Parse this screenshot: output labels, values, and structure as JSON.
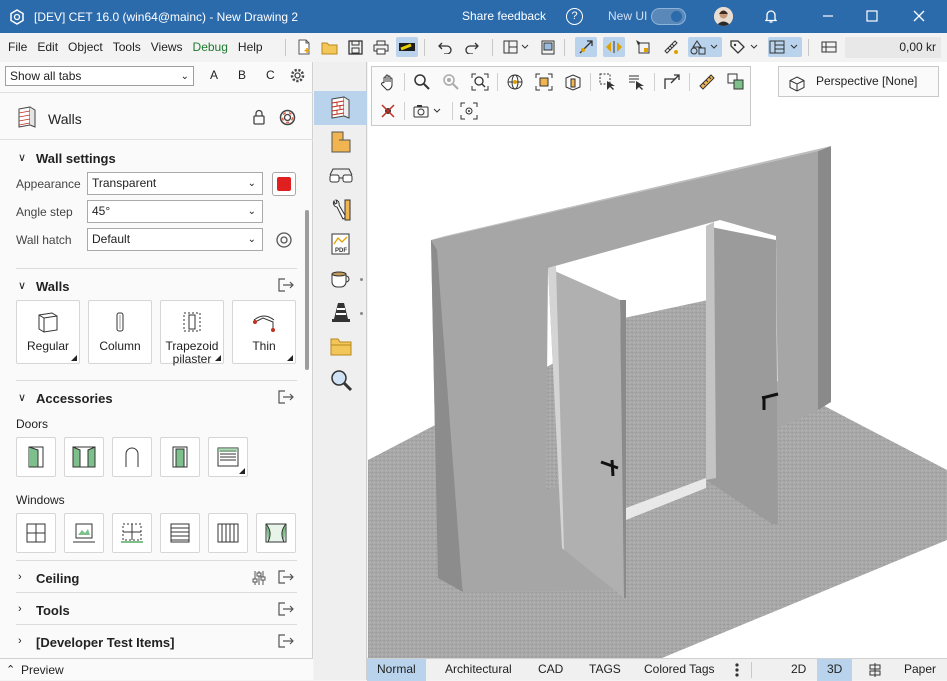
{
  "titlebar": {
    "title": "[DEV] CET 16.0 (win64@mainc) - New Drawing 2",
    "share_feedback": "Share feedback",
    "help": "?",
    "new_ui_label": "New UI"
  },
  "menu": [
    "File",
    "Edit",
    "Object",
    "Tools",
    "Views",
    "Debug",
    "Help"
  ],
  "toolbar": {
    "cost": "0,00 kr"
  },
  "left_panel": {
    "tab_filter": "Show all tabs",
    "abc": [
      "A",
      "B",
      "C"
    ],
    "panel_title": "Walls",
    "wall_settings": {
      "heading": "Wall settings",
      "appearance_label": "Appearance",
      "appearance_value": "Transparent",
      "angle_label": "Angle step",
      "angle_value": "45°",
      "hatch_label": "Wall hatch",
      "hatch_value": "Default",
      "color": "#e02020"
    },
    "walls": {
      "heading": "Walls",
      "tiles": [
        {
          "label": "Regular"
        },
        {
          "label": "Column"
        },
        {
          "label": "Trapezoid pilaster"
        },
        {
          "label": "Thin"
        }
      ]
    },
    "accessories": {
      "heading": "Accessories",
      "doors_label": "Doors",
      "windows_label": "Windows"
    },
    "ceiling": {
      "heading": "Ceiling"
    },
    "tools": {
      "heading": "Tools"
    },
    "dev": {
      "heading": "[Developer Test Items]"
    },
    "preview": "Preview"
  },
  "viewport": {
    "perspective_label": "Perspective [None]"
  },
  "bottom_tabs": [
    "Normal",
    "Architectural",
    "CAD",
    "TAGS",
    "Colored Tags"
  ],
  "view_modes": [
    "2D",
    "3D"
  ],
  "paper": "Paper"
}
